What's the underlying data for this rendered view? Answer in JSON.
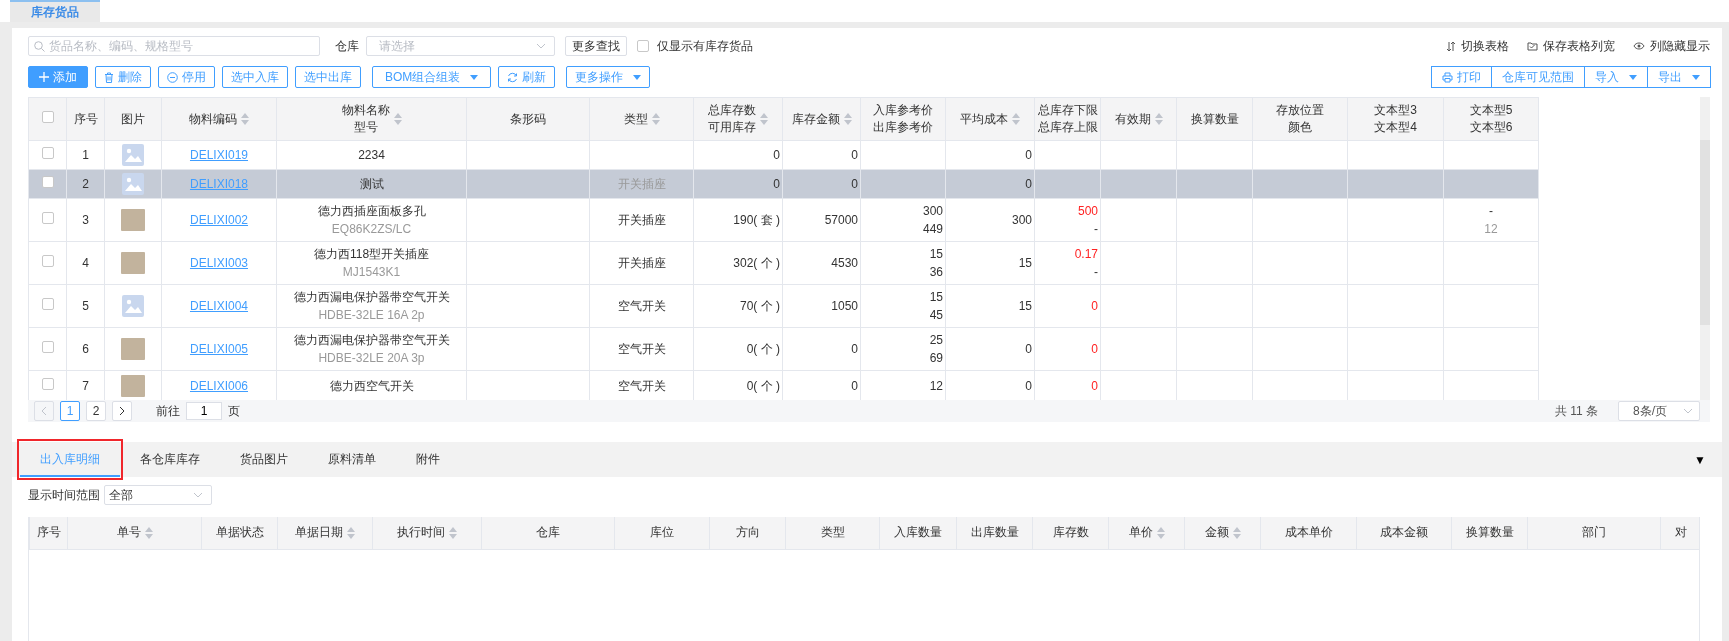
{
  "top_tabs": [
    {
      "label": "库存货品",
      "selected": true
    }
  ],
  "search": {
    "placeholder": "货品名称、编码、规格型号"
  },
  "warehouse_filter": {
    "label": "仓库",
    "placeholder": "请选择"
  },
  "more_search_button": "更多查找",
  "in_stock_only": {
    "label": "仅显示有库存货品",
    "checked": false
  },
  "view_links": [
    {
      "kind": "switch",
      "label": "切换表格"
    },
    {
      "kind": "save",
      "label": "保存表格列宽"
    },
    {
      "kind": "columns",
      "label": "列隐藏显示"
    }
  ],
  "toolbar": [
    {
      "kind": "add",
      "label": "添加"
    },
    {
      "kind": "delete",
      "label": "删除"
    },
    {
      "kind": "disable",
      "label": "停用"
    },
    {
      "kind": "plain",
      "label": "选中入库"
    },
    {
      "kind": "plain",
      "label": "选中出库"
    },
    {
      "kind": "menu",
      "label": "BOM组合组装"
    },
    {
      "kind": "refresh",
      "label": "刷新"
    },
    {
      "kind": "menu",
      "label": "更多操作"
    }
  ],
  "export_buttons": [
    {
      "kind": "print",
      "label": "打印"
    },
    {
      "kind": "plain",
      "label": "仓库可见范围"
    },
    {
      "kind": "menu",
      "label": "导入"
    },
    {
      "kind": "menu",
      "label": "导出"
    }
  ],
  "table": {
    "select_all": {
      "checked": false
    },
    "columns": [
      {
        "label": "序号",
        "sortable": false
      },
      {
        "label": "图片",
        "sortable": false
      },
      {
        "label": "物料编码",
        "sortable": true
      },
      {
        "label": "物料名称",
        "label_2": "型号",
        "sortable": true
      },
      {
        "label": "条形码",
        "sortable": false
      },
      {
        "label": "类型",
        "sortable": true
      },
      {
        "label": "总库存数",
        "label_2": "可用库存",
        "sortable": true
      },
      {
        "label": "库存金额",
        "sortable": true
      },
      {
        "label": "入库参考价",
        "label_2": "出库参考价",
        "sortable": false
      },
      {
        "label": "平均成本",
        "sortable": true
      },
      {
        "label": "总库存下限",
        "label_2": "总库存上限",
        "sortable": false
      },
      {
        "label": "有效期",
        "sortable": true
      },
      {
        "label": "换算数量",
        "sortable": false
      },
      {
        "label": "存放位置",
        "label_2": "颜色",
        "sortable": false
      },
      {
        "label": "文本型3",
        "label_2": "文本型4",
        "sortable": false
      },
      {
        "label": "文本型5",
        "label_2": "文本型6",
        "sortable": false
      }
    ],
    "rows": [
      {
        "selected": false,
        "checked": false,
        "no": "1",
        "kind": "no_image",
        "code": "DELIXI019",
        "name": "2234",
        "stock": "0",
        "amount": "0",
        "avg_cost": "0"
      },
      {
        "selected": true,
        "checked": false,
        "no": "2",
        "kind": "no_image",
        "code": "DELIXI018",
        "name": "测试",
        "type": "开关插座",
        "stock": "0",
        "amount": "0",
        "avg_cost": "0"
      },
      {
        "selected": false,
        "checked": false,
        "no": "3",
        "kind": "photo",
        "code": "DELIXI002",
        "name": "德力西插座面板多孔",
        "model": "EQ86K2ZS/LC",
        "type": "开关插座",
        "stock": "190( 套 )",
        "amount": "57000",
        "in_price": "300",
        "out_price": "449",
        "avg_cost": "300",
        "lower_limit": "500",
        "upper_limit": "-",
        "text_5": "-",
        "text_6": "12"
      },
      {
        "selected": false,
        "checked": false,
        "no": "4",
        "kind": "photo",
        "code": "DELIXI003",
        "name": "德力西118型开关插座",
        "model": "MJ1543K1",
        "type": "开关插座",
        "stock": "302( 个 )",
        "amount": "4530",
        "in_price": "15",
        "out_price": "36",
        "avg_cost": "15",
        "lower_limit": "0.17",
        "upper_limit": "-"
      },
      {
        "selected": false,
        "checked": false,
        "no": "5",
        "kind": "no_image",
        "code": "DELIXI004",
        "name": "德力西漏电保护器带空气开关",
        "model": "HDBE-32LE 16A 2p",
        "type": "空气开关",
        "stock": "70( 个 )",
        "amount": "1050",
        "in_price": "15",
        "out_price": "45",
        "avg_cost": "15",
        "lower_limit": "0"
      },
      {
        "selected": false,
        "checked": false,
        "no": "6",
        "kind": "photo",
        "code": "DELIXI005",
        "name": "德力西漏电保护器带空气开关",
        "model": "HDBE-32LE 20A 3p",
        "type": "空气开关",
        "stock": "0( 个 )",
        "amount": "0",
        "in_price": "25",
        "out_price": "69",
        "avg_cost": "0",
        "lower_limit": "0"
      },
      {
        "selected": false,
        "checked": false,
        "no": "7",
        "kind": "photo",
        "code": "DELIXI006",
        "name": "德力西空气开关",
        "type": "空气开关",
        "stock": "0( 个 )",
        "amount": "0",
        "in_price": "12",
        "avg_cost": "0",
        "lower_limit": "0"
      }
    ]
  },
  "pagination": {
    "prev": {
      "disabled": true
    },
    "next": {
      "disabled": false
    },
    "pages": [
      {
        "label": "1",
        "selected": true
      },
      {
        "label": "2",
        "selected": false
      }
    ],
    "goto_label": "前往",
    "goto_value": "1",
    "goto_suffix": "页",
    "total": "共 11 条",
    "page_size": "8条/页"
  },
  "detail_tabs": [
    {
      "label": "出入库明细",
      "selected": true,
      "highlighted": true
    },
    {
      "label": "各仓库库存",
      "selected": false,
      "highlighted": false
    },
    {
      "label": "货品图片",
      "selected": false,
      "highlighted": false
    },
    {
      "label": "原料清单",
      "selected": false,
      "highlighted": false
    },
    {
      "label": "附件",
      "selected": false,
      "highlighted": false
    }
  ],
  "collapse_toggle": "▼",
  "time_range": {
    "label": "显示时间范围",
    "value": "全部"
  },
  "detail_table": {
    "columns": [
      {
        "label": "序号",
        "sortable": false
      },
      {
        "label": "单号",
        "sortable": true
      },
      {
        "label": "单据状态",
        "sortable": false
      },
      {
        "label": "单据日期",
        "sortable": true
      },
      {
        "label": "执行时间",
        "sortable": true
      },
      {
        "label": "仓库",
        "sortable": false
      },
      {
        "label": "库位",
        "sortable": false
      },
      {
        "label": "方向",
        "sortable": false
      },
      {
        "label": "类型",
        "sortable": false
      },
      {
        "label": "入库数量",
        "sortable": false
      },
      {
        "label": "出库数量",
        "sortable": false
      },
      {
        "label": "库存数",
        "sortable": false
      },
      {
        "label": "单价",
        "sortable": true
      },
      {
        "label": "金额",
        "sortable": true
      },
      {
        "label": "成本单价",
        "sortable": false
      },
      {
        "label": "成本金额",
        "sortable": false
      },
      {
        "label": "换算数量",
        "sortable": false
      },
      {
        "label": "部门",
        "sortable": false
      },
      {
        "label": "对",
        "sortable": false
      }
    ]
  }
}
